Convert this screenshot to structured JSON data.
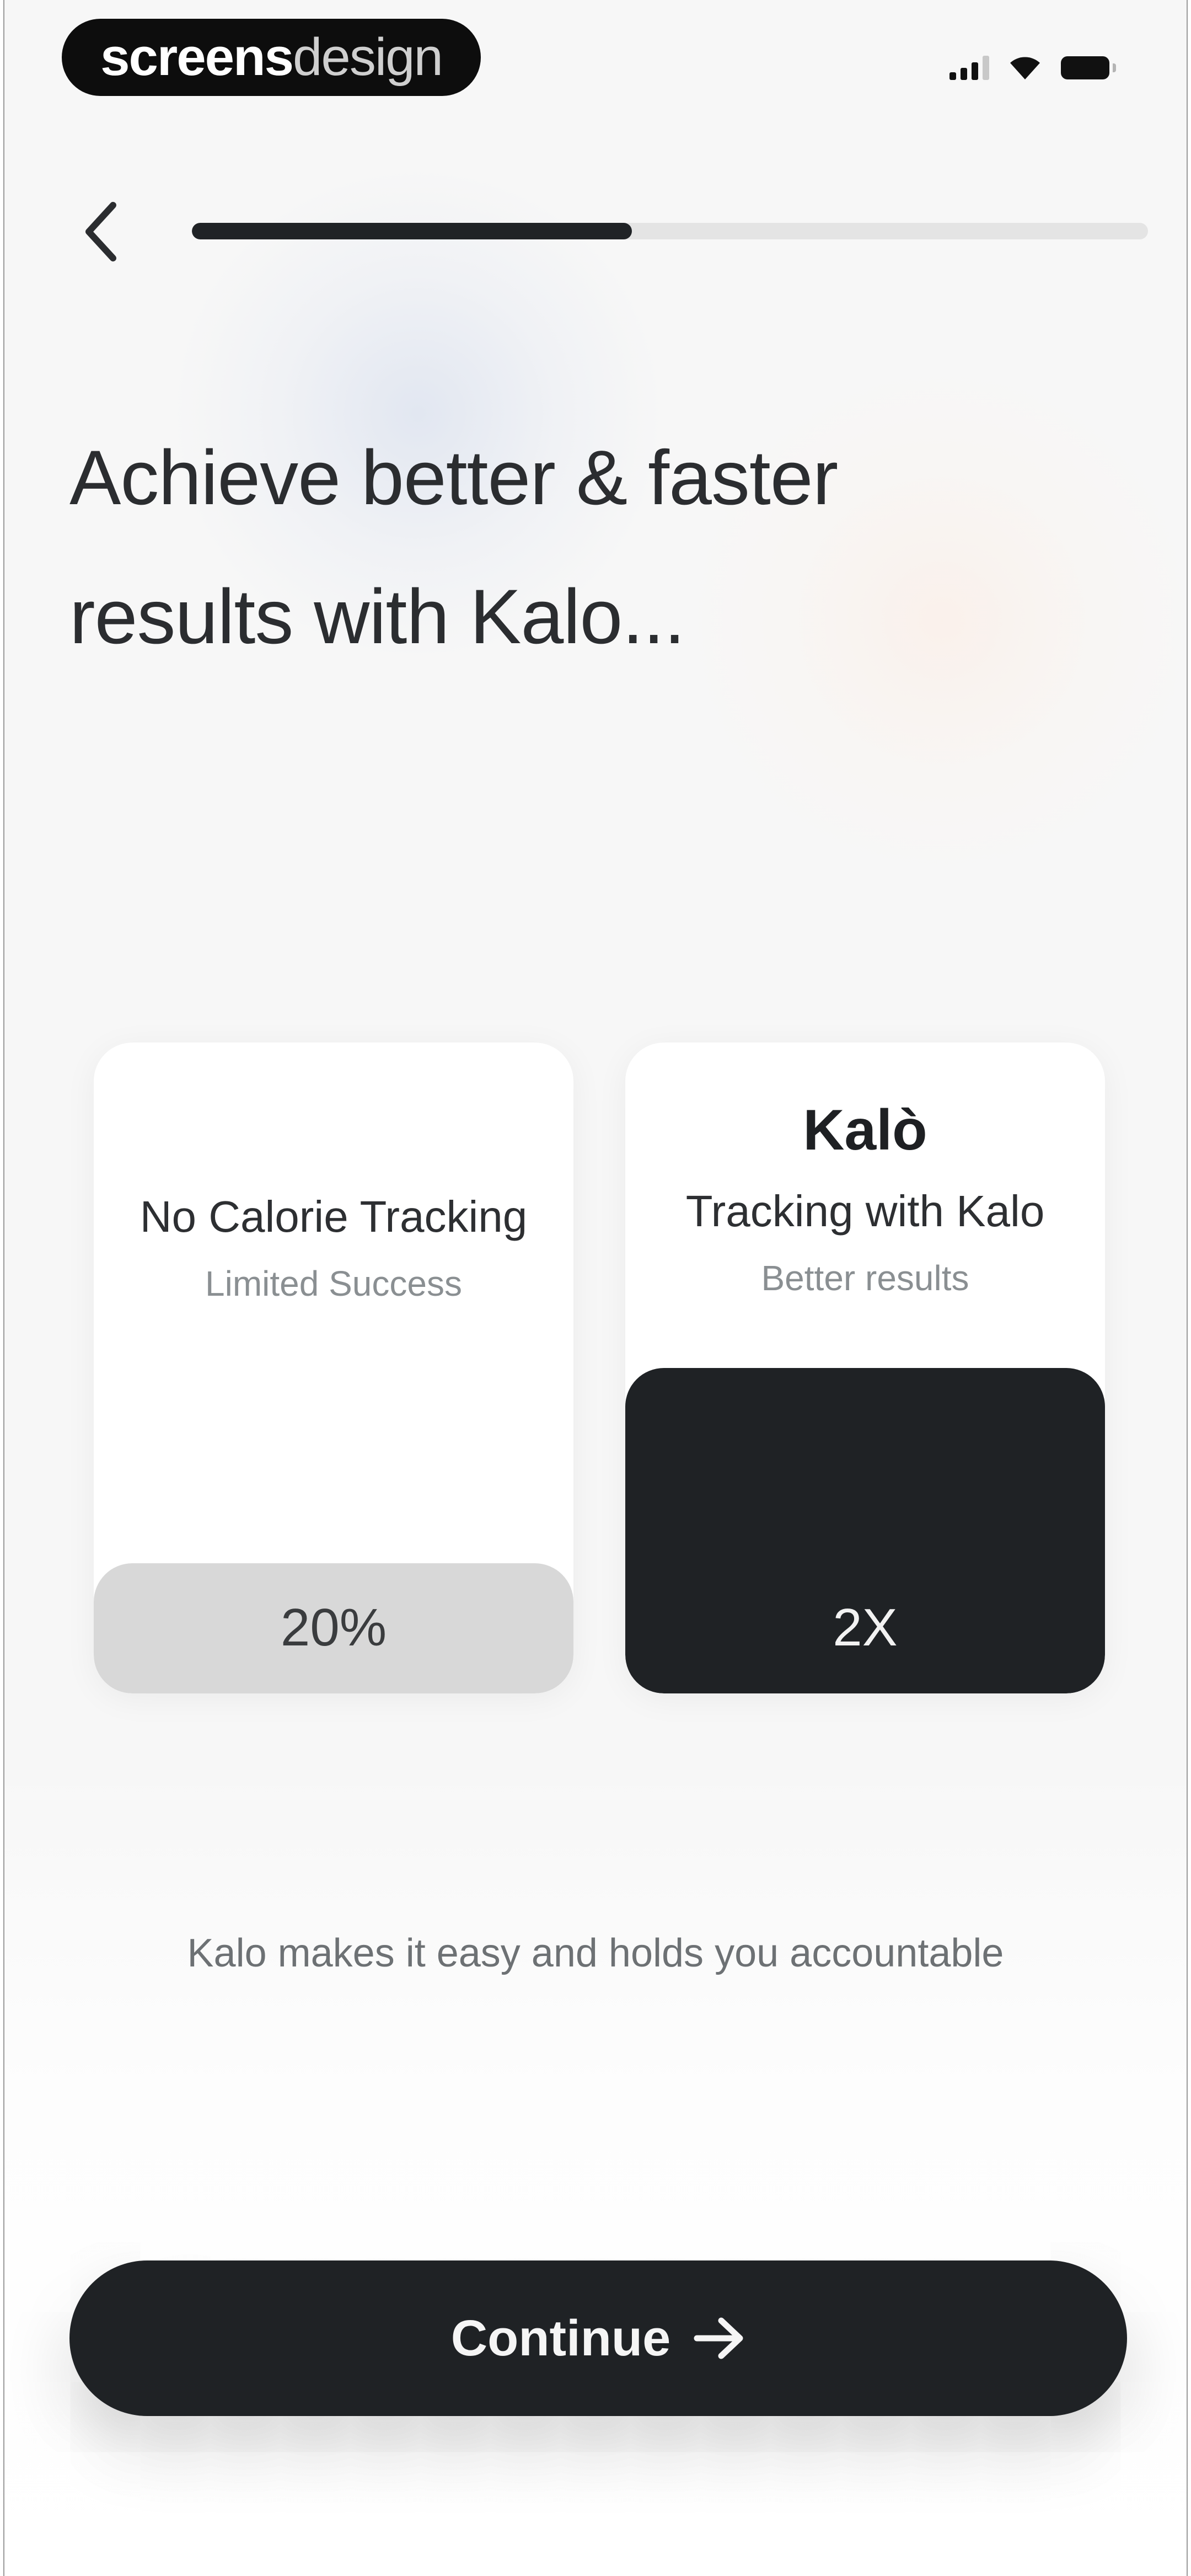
{
  "watermark": {
    "part1": "screens",
    "part2": "design"
  },
  "status_bar": {
    "icons": [
      "signal-icon",
      "wifi-icon",
      "battery-icon"
    ]
  },
  "nav": {
    "back_icon": "chevron-left-icon",
    "progress": 0.46
  },
  "headline": "Achieve better & faster results with Kalo...",
  "comparison": {
    "left": {
      "title": "No Calorie Tracking",
      "subtitle": "Limited Success",
      "value_label": "20%"
    },
    "right": {
      "brand": "Kalò",
      "title": "Tracking with Kalo",
      "subtitle": "Better results",
      "value_label": "2X"
    }
  },
  "caption": "Kalo makes it easy and holds you accountable",
  "cta": {
    "label": "Continue",
    "icon": "arrow-right-icon"
  },
  "colors": {
    "accent_dark": "#1f2225",
    "muted_bar": "#d8d8d8",
    "background": "#f7f7f7"
  }
}
